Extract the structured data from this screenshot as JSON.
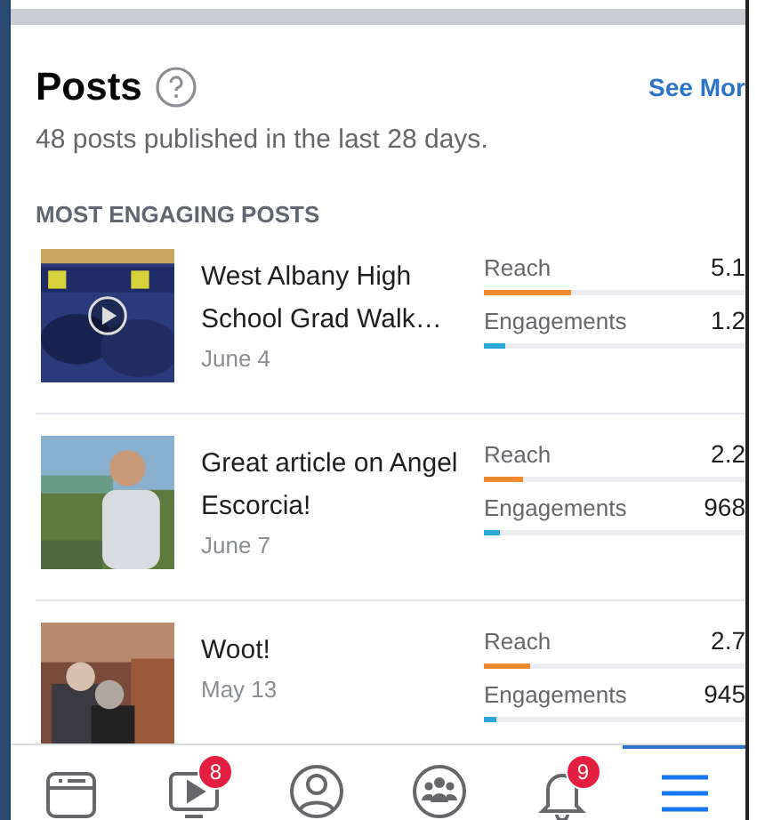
{
  "header": {
    "title": "Posts",
    "link": "See Mor",
    "subtitle": "48 posts published in the last 28 days."
  },
  "section_title": "MOST ENGAGING POSTS",
  "posts": [
    {
      "title": "West Albany High School Grad Walk…",
      "date": "June 4",
      "video": true,
      "metrics": [
        {
          "label": "Reach",
          "value": "5.1",
          "level": 0.33
        },
        {
          "label": "Engagements",
          "value": "1.2",
          "level": 0.08
        }
      ]
    },
    {
      "title": "Great article on Angel Escorcia!",
      "date": "June 7",
      "video": false,
      "metrics": [
        {
          "label": "Reach",
          "value": "2.2",
          "level": 0.15
        },
        {
          "label": "Engagements",
          "value": "968",
          "level": 0.06
        }
      ]
    },
    {
      "title": "Woot!",
      "date": "May 13",
      "video": false,
      "metrics": [
        {
          "label": "Reach",
          "value": "2.7",
          "level": 0.18
        },
        {
          "label": "Engagements",
          "value": "945",
          "level": 0.05
        }
      ]
    }
  ],
  "nav": [
    {
      "kind": "feed",
      "selected": false
    },
    {
      "kind": "watch",
      "badge": "8",
      "selected": false
    },
    {
      "kind": "profile",
      "selected": false
    },
    {
      "kind": "groups",
      "selected": false
    },
    {
      "kind": "bell",
      "badge": "9",
      "selected": false
    },
    {
      "kind": "menu",
      "selected": true
    }
  ]
}
